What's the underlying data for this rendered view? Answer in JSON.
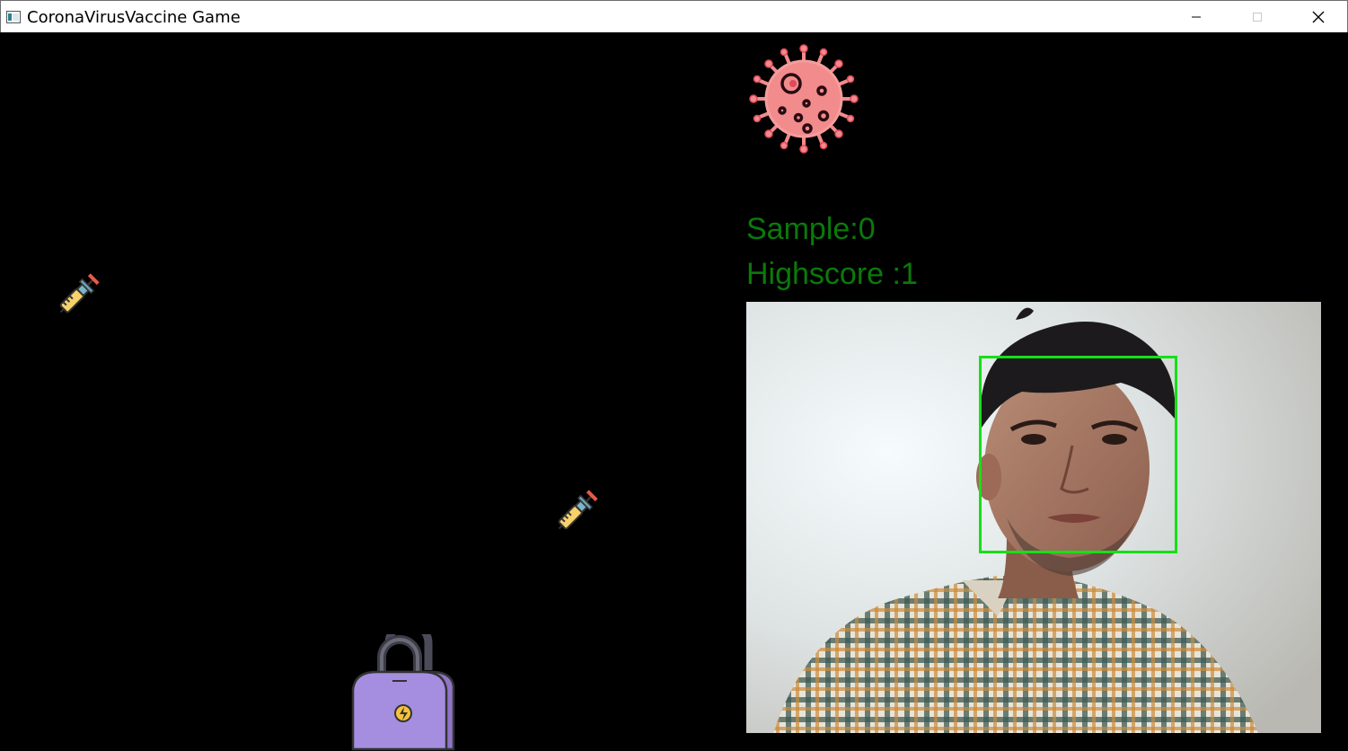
{
  "window": {
    "title": "CoronaVirusVaccine Game",
    "icons": [
      "app-icon",
      "minimize-icon",
      "maximize-icon",
      "close-icon"
    ]
  },
  "hud": {
    "sample": "Sample:0",
    "highscore": "Highscore :1",
    "text_color": "#0a7a0a"
  },
  "sprites": [
    "virus-icon",
    "syringe-icon",
    "syringe-icon",
    "vaccine-bag-icon"
  ],
  "webcam": {
    "face_box_color": "#16e016"
  }
}
